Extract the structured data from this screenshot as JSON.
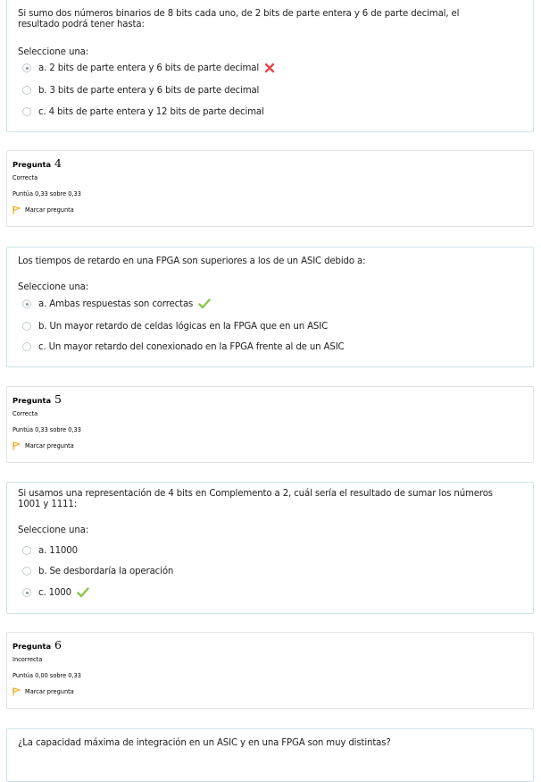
{
  "q3_tail": {
    "text": "Si sumo dos números binarios de 8 bits cada uno, de 2 bits de parte entera y 6 de parte decimal, el resultado podrá tener hasta:",
    "prompt": "Seleccione una:",
    "options": [
      {
        "label": "a. 2 bits de parte entera y 6 bits de parte decimal",
        "selected": true,
        "feedback": "incorrect"
      },
      {
        "label": "b. 3 bits de parte entera y 6 bits de parte decimal",
        "selected": false,
        "feedback": ""
      },
      {
        "label": "c. 4 bits de parte entera y 12 bits de parte decimal",
        "selected": false,
        "feedback": ""
      }
    ]
  },
  "q4": {
    "info": {
      "label": "Pregunta",
      "number": "4",
      "state": "Correcta",
      "grade": "Puntúa 0,33 sobre 0,33",
      "flag": "Marcar pregunta"
    },
    "text": "Los tiempos de retardo en una FPGA son superiores a los de un ASIC debido a:",
    "prompt": "Seleccione una:",
    "options": [
      {
        "label": "a. Ambas respuestas son correctas",
        "selected": true,
        "feedback": "correct"
      },
      {
        "label": "b. Un mayor retardo de celdas lógicas en la FPGA que en un ASIC",
        "selected": false,
        "feedback": ""
      },
      {
        "label": "c. Un mayor retardo del conexionado en la FPGA frente al de un ASIC",
        "selected": false,
        "feedback": ""
      }
    ]
  },
  "q5": {
    "info": {
      "label": "Pregunta",
      "number": "5",
      "state": "Correcta",
      "grade": "Puntúa 0,33 sobre 0,33",
      "flag": "Marcar pregunta"
    },
    "text": "Si usamos una representación de 4 bits en Complemento a 2, cuál sería el resultado de sumar los números 1001 y 1111:",
    "prompt": "Seleccione una:",
    "options": [
      {
        "label": "a. 11000",
        "selected": false,
        "feedback": ""
      },
      {
        "label": "b. Se desbordaría la operación",
        "selected": false,
        "feedback": ""
      },
      {
        "label": "c. 1000",
        "selected": true,
        "feedback": "correct"
      }
    ]
  },
  "q6": {
    "info": {
      "label": "Pregunta",
      "number": "6",
      "state": "Incorrecta",
      "grade": "Puntúa 0,00 sobre 0,33",
      "flag": "Marcar pregunta"
    },
    "text": "¿La capacidad máxima de integración en un ASIC y en una FPGA son muy distintas?"
  },
  "colors": {
    "correct": "#8bc34a",
    "incorrect": "#e8474c",
    "flag": "#f0a81e",
    "border": "#cfe3ea"
  }
}
